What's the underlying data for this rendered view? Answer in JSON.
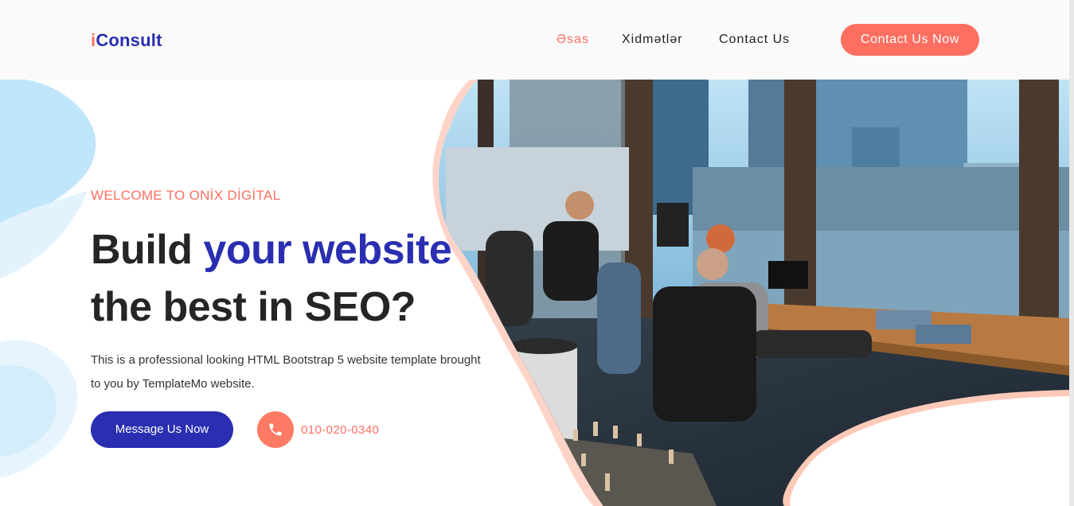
{
  "header": {
    "logo": {
      "accent": "i",
      "rest": "Consult"
    },
    "nav": [
      {
        "label": "Əsas",
        "active": true
      },
      {
        "label": "Xidmətlər",
        "active": false
      },
      {
        "label": "Contact Us",
        "active": false
      }
    ],
    "cta_label": "Contact Us Now"
  },
  "hero": {
    "eyebrow": "WELCOME TO ONİX DİGİTAL",
    "headline_line1_plain": "Build ",
    "headline_line1_highlight": "your website",
    "headline_line2": "the best in SEO?",
    "description": "This is a professional looking HTML Bootstrap 5 website template brought to you by TemplateMo website.",
    "message_button_label": "Message Us Now",
    "phone_icon": "phone-icon",
    "phone_number": "010-020-0340"
  },
  "colors": {
    "brand_blue": "#2a2eb0",
    "accent_coral": "#fe6f61",
    "text_dark": "#252525"
  }
}
